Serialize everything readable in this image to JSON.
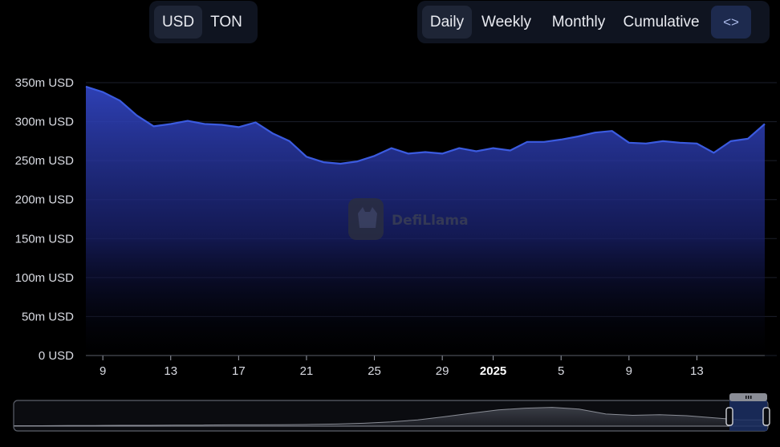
{
  "currency_toggle": {
    "options": [
      "USD",
      "TON"
    ],
    "selected": "USD"
  },
  "period_toggle": {
    "options": [
      "Daily",
      "Weekly",
      "Monthly",
      "Cumulative"
    ],
    "selected": "Daily",
    "embed_icon": "code-brackets-icon",
    "embed_label": "<>"
  },
  "watermark": "DefiLlama",
  "colors": {
    "line": "#3b5be0",
    "area_top": "#3347c8",
    "area_bottom": "#000000",
    "toggle_bg": "#0f1420",
    "active_bg": "#1e2536"
  },
  "chart_data": {
    "type": "area",
    "y_tick_labels": [
      "0 USD",
      "50m USD",
      "100m USD",
      "150m USD",
      "200m USD",
      "250m USD",
      "300m USD",
      "350m USD"
    ],
    "x_tick_labels": [
      "9",
      "13",
      "17",
      "21",
      "25",
      "29",
      "2025",
      "5",
      "9",
      "13"
    ],
    "ylim": [
      0,
      350
    ],
    "grid": true,
    "x_start": "2024-12-08",
    "x_end": "2025-01-16",
    "series": [
      {
        "values": [
          345,
          338,
          327,
          308,
          294,
          297,
          301,
          297,
          296,
          293,
          299,
          285,
          275,
          255,
          248,
          246,
          249,
          256,
          266,
          259,
          261,
          259,
          266,
          262,
          266,
          263,
          274,
          274,
          277,
          281,
          286,
          288,
          273,
          272,
          275,
          273,
          272,
          260,
          275,
          278,
          297
        ]
      }
    ]
  },
  "navigator": {
    "shape": [
      0.02,
      0.02,
      0.03,
      0.03,
      0.04,
      0.04,
      0.05,
      0.05,
      0.06,
      0.06,
      0.07,
      0.08,
      0.1,
      0.14,
      0.2,
      0.3,
      0.45,
      0.62,
      0.78,
      0.86,
      0.9,
      0.82,
      0.58,
      0.52,
      0.55,
      0.5,
      0.4,
      0.3,
      0.3
    ],
    "grip_icon": "handle-grip-icon"
  }
}
